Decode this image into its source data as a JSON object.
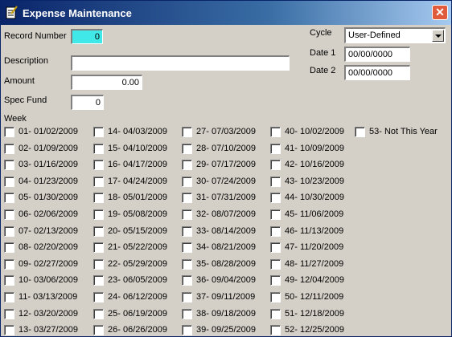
{
  "window": {
    "title": "Expense Maintenance",
    "close_symbol": "✕"
  },
  "form": {
    "record_number_label": "Record Number",
    "record_number": "0",
    "description_label": "Description",
    "description": "",
    "amount_label": "Amount",
    "amount": "0.00",
    "spec_fund_label": "Spec Fund",
    "spec_fund": "0",
    "cycle_label": "Cycle",
    "cycle": "User-Defined",
    "date1_label": "Date 1",
    "date1": "00/00/0000",
    "date2_label": "Date 2",
    "date2": "00/00/0000",
    "week_label": "Week"
  },
  "weeks": [
    "01- 01/02/2009",
    "02- 01/09/2009",
    "03- 01/16/2009",
    "04- 01/23/2009",
    "05- 01/30/2009",
    "06- 02/06/2009",
    "07- 02/13/2009",
    "08- 02/20/2009",
    "09- 02/27/2009",
    "10- 03/06/2009",
    "11- 03/13/2009",
    "12- 03/20/2009",
    "13- 03/27/2009",
    "14- 04/03/2009",
    "15- 04/10/2009",
    "16- 04/17/2009",
    "17- 04/24/2009",
    "18- 05/01/2009",
    "19- 05/08/2009",
    "20- 05/15/2009",
    "21- 05/22/2009",
    "22- 05/29/2009",
    "23- 06/05/2009",
    "24- 06/12/2009",
    "25- 06/19/2009",
    "26- 06/26/2009",
    "27- 07/03/2009",
    "28- 07/10/2009",
    "29- 07/17/2009",
    "30- 07/24/2009",
    "31- 07/31/2009",
    "32- 08/07/2009",
    "33- 08/14/2009",
    "34- 08/21/2009",
    "35- 08/28/2009",
    "36- 09/04/2009",
    "37- 09/11/2009",
    "38- 09/18/2009",
    "39- 09/25/2009",
    "40- 10/02/2009",
    "41- 10/09/2009",
    "42- 10/16/2009",
    "43- 10/23/2009",
    "44- 10/30/2009",
    "45- 11/06/2009",
    "46- 11/13/2009",
    "47- 11/20/2009",
    "48- 11/27/2009",
    "49- 12/04/2009",
    "50- 12/11/2009",
    "51- 12/18/2009",
    "52- 12/25/2009",
    "53- Not This Year"
  ]
}
